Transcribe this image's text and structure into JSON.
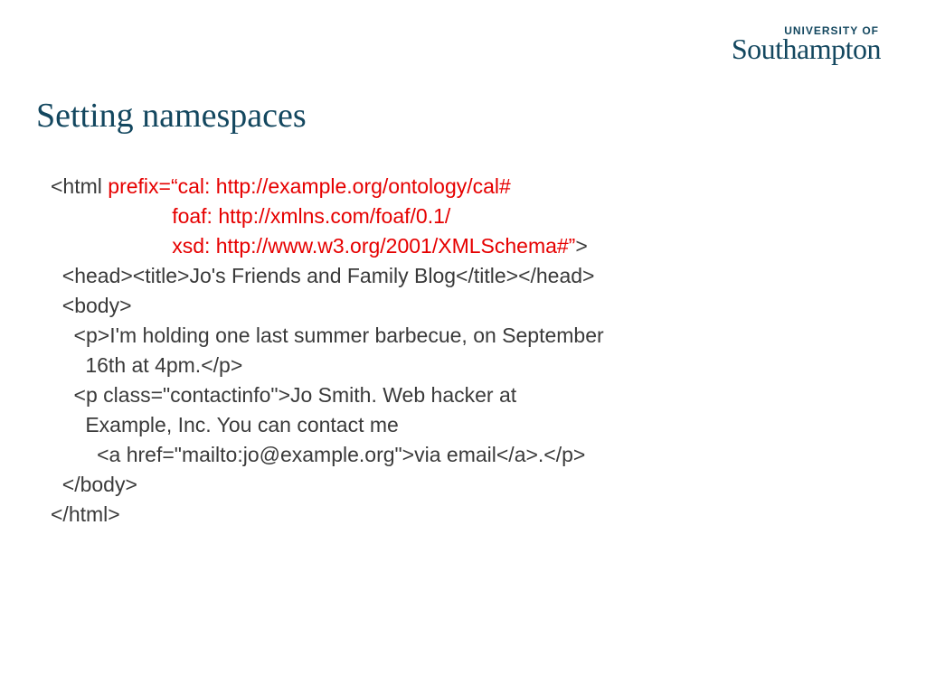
{
  "logo": {
    "small": "UNIVERSITY OF",
    "big": "Southampton"
  },
  "title": "Setting namespaces",
  "code": {
    "l1a": "<html ",
    "l1b": "prefix=“cal: http://example.org/ontology/cal#",
    "l2": "                     foaf: http://xmlns.com/foaf/0.1/",
    "l3a": "                     xsd: http://www.w3.org/2001/XMLSchema#”",
    "l3b": ">",
    "l4": "  <head><title>Jo's Friends and Family Blog</title></head>",
    "l5": "  <body>",
    "l6": "    <p>I'm holding one last summer barbecue, on September",
    "l7": "      16th at 4pm.</p>",
    "l8": "    <p class=\"contactinfo\">Jo Smith. Web hacker at",
    "l9": "      Example, Inc. You can contact me",
    "l10": "        <a href=\"mailto:jo@example.org\">via email</a>.</p>",
    "l11": "  </body>",
    "l12": "</html>"
  }
}
